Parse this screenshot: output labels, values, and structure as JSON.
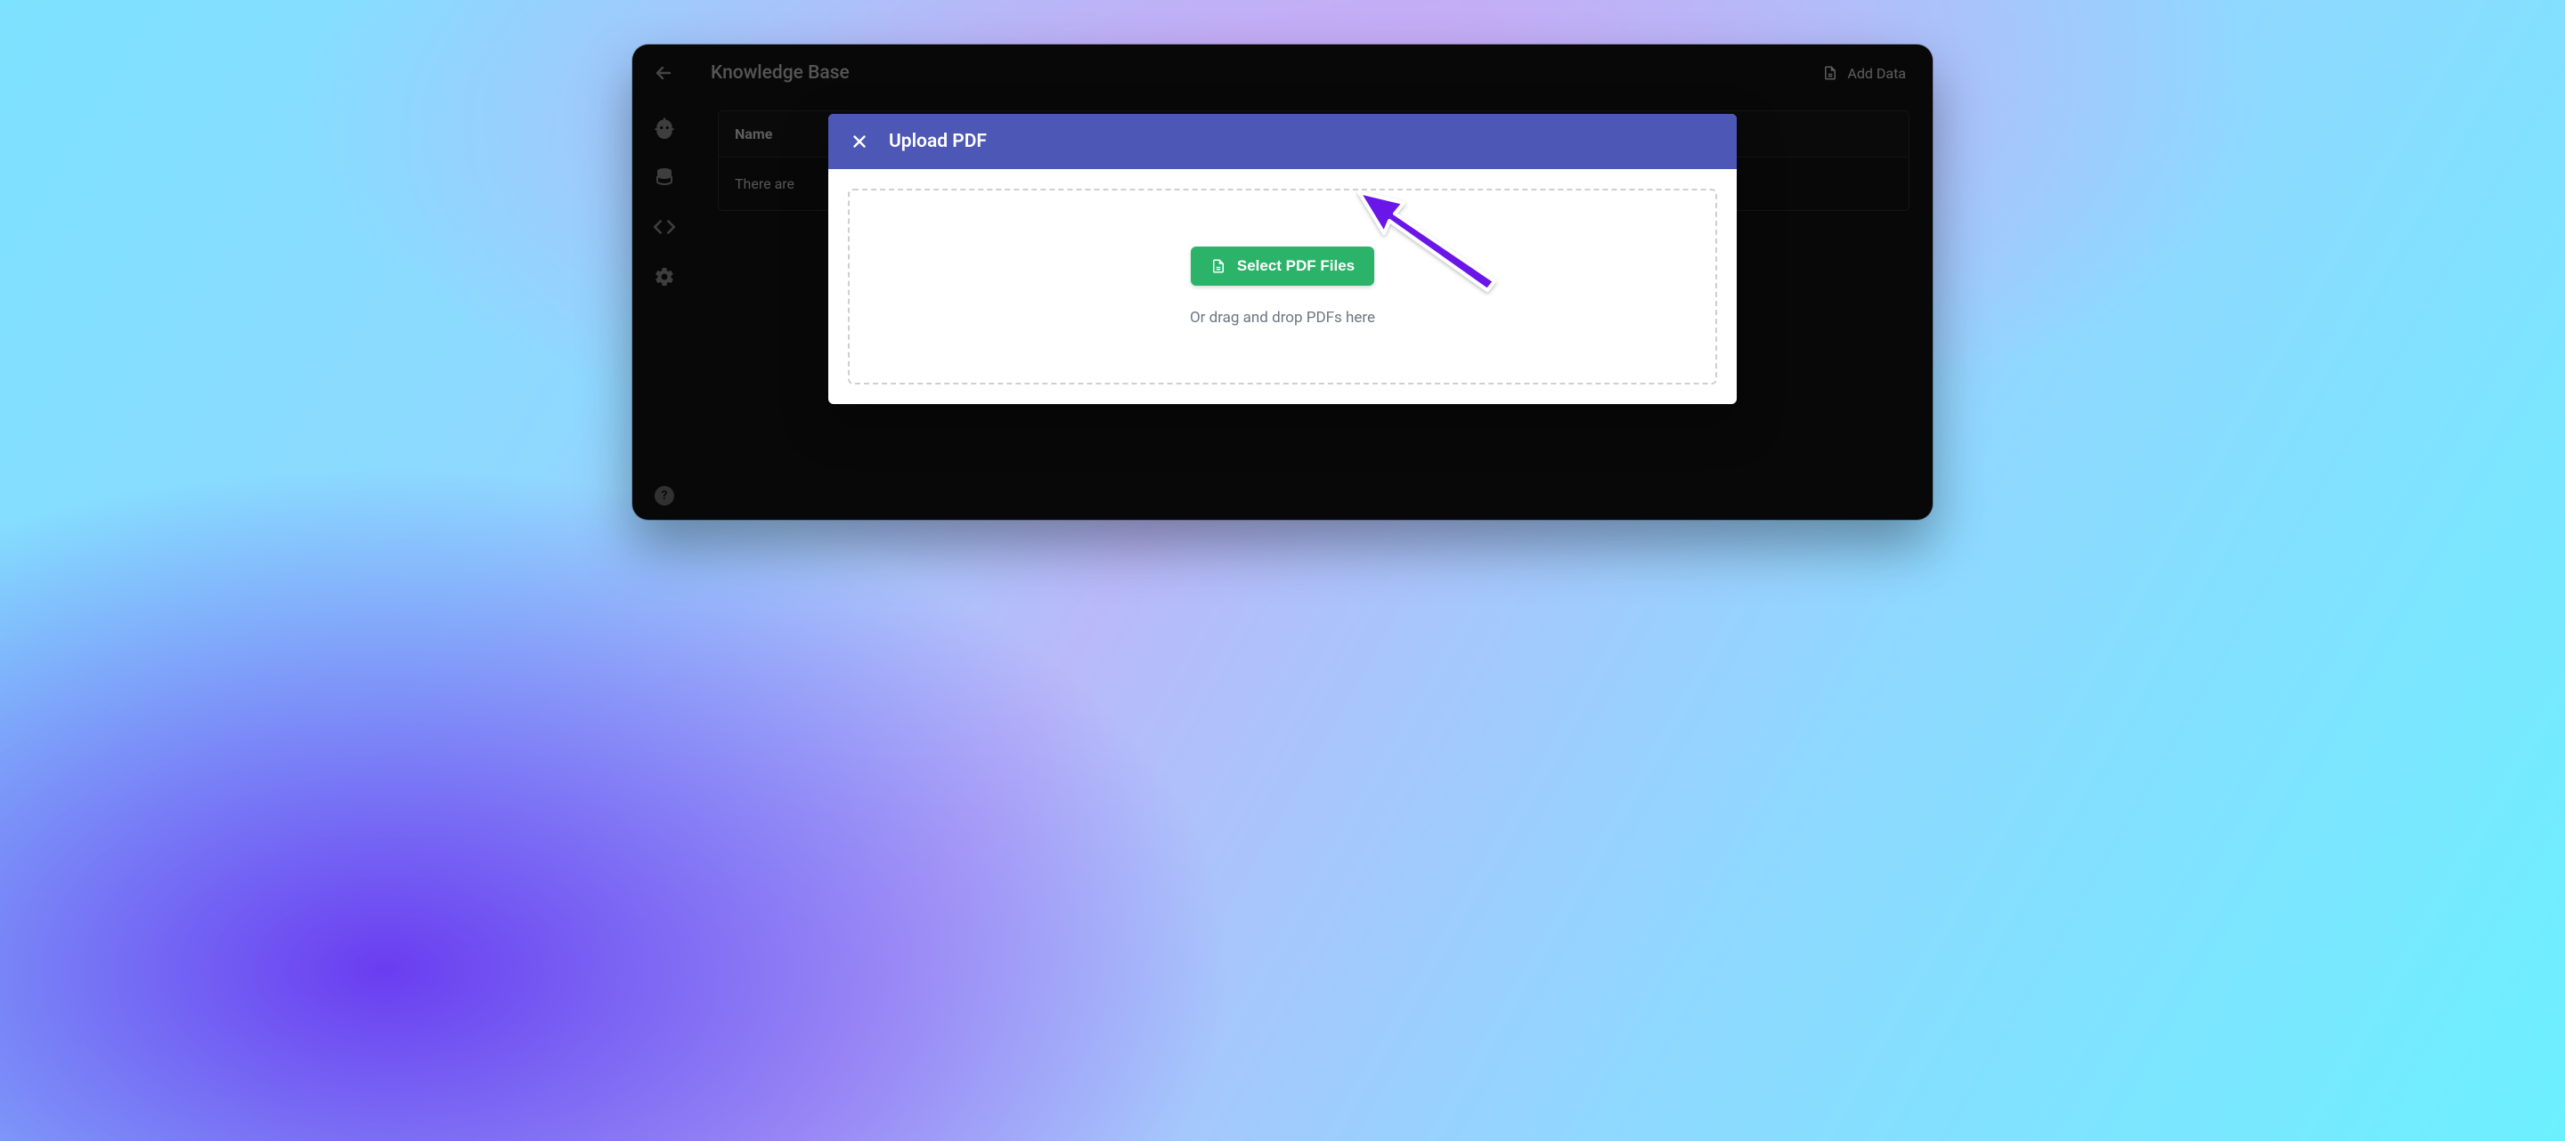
{
  "header": {
    "title": "Knowledge Base",
    "add_data_label": "Add Data"
  },
  "table": {
    "col_name": "Name",
    "empty_row_text": "There are"
  },
  "modal": {
    "title": "Upload PDF",
    "select_button": "Select PDF Files",
    "drop_hint": "Or drag and drop PDFs here"
  },
  "icons": {
    "back": "arrow-left",
    "robot": "robot",
    "database": "database",
    "code": "code",
    "gear": "gear",
    "help": "?",
    "file": "file",
    "close": "close"
  },
  "colors": {
    "modal_header": "#4c57b6",
    "select_button": "#2cb36a",
    "arrow": "#6a16e8"
  }
}
